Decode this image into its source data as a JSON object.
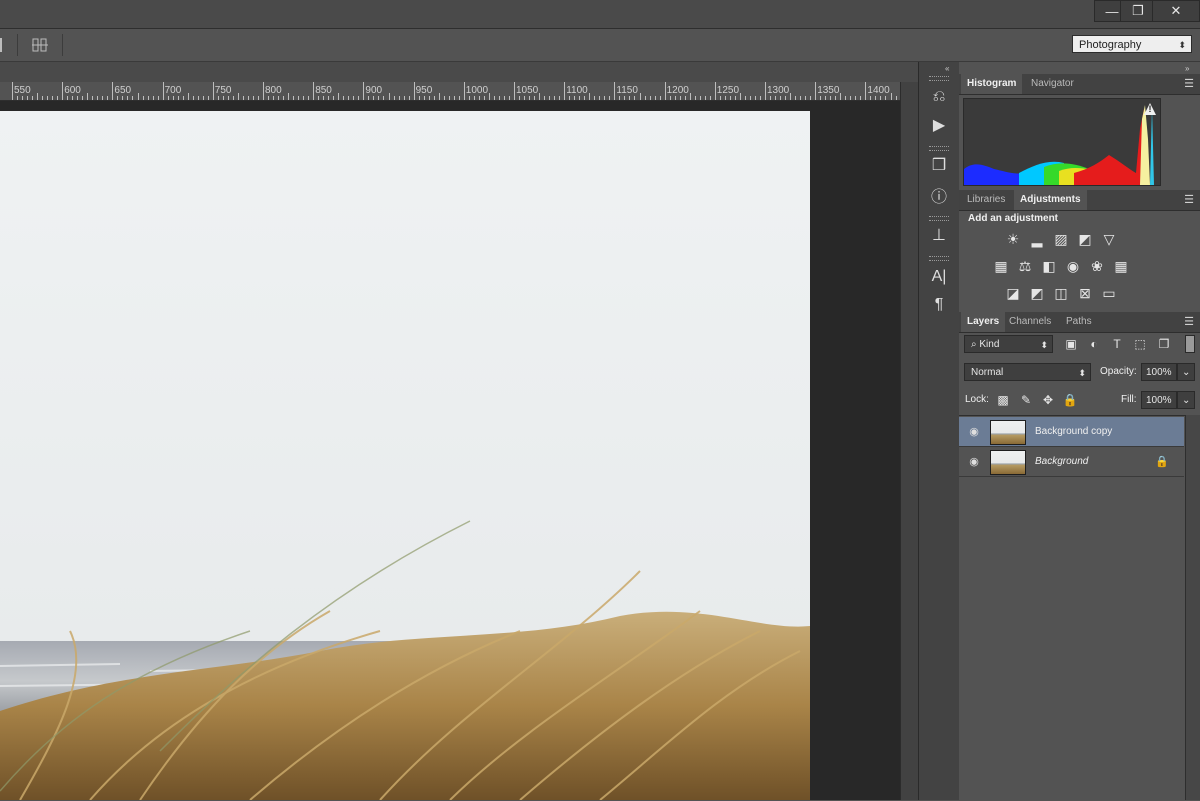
{
  "window_controls": {
    "minimize": "—",
    "restore": "❐",
    "close": "✕"
  },
  "options_bar": {
    "workspace": "Photography"
  },
  "ruler": {
    "unit_labels": [
      "550",
      "600",
      "650",
      "700",
      "750",
      "800",
      "850",
      "900",
      "950",
      "1000",
      "1050",
      "1100",
      "1150",
      "1200",
      "1250",
      "1300",
      "1350",
      "1400"
    ]
  },
  "panels": {
    "histogram": {
      "tabs": [
        "Histogram",
        "Navigator"
      ],
      "active": "Histogram",
      "warning": "!"
    },
    "adjustments": {
      "tabs": [
        "Libraries",
        "Adjustments"
      ],
      "active": "Adjustments",
      "heading": "Add an adjustment",
      "icons": [
        "brightness-contrast-icon",
        "levels-icon",
        "curves-icon",
        "exposure-icon",
        "vibrance-icon",
        "hue-saturation-icon",
        "color-balance-icon",
        "black-white-icon",
        "photo-filter-icon",
        "channel-mixer-icon",
        "color-lookup-icon",
        "invert-icon",
        "posterize-icon",
        "threshold-icon",
        "selective-color-icon",
        "gradient-map-icon"
      ]
    },
    "layers": {
      "tabs": [
        "Layers",
        "Channels",
        "Paths"
      ],
      "active": "Layers",
      "filter_kind": "Kind",
      "blend_mode": "Normal",
      "opacity_label": "Opacity:",
      "opacity_value": "100%",
      "lock_label": "Lock:",
      "fill_label": "Fill:",
      "fill_value": "100%",
      "layers": [
        {
          "name": "Background copy",
          "selected": true,
          "locked": false
        },
        {
          "name": "Background",
          "selected": false,
          "locked": true
        }
      ]
    }
  },
  "colors": {
    "selected_layer": "#6b7c95",
    "panel_bg": "#535353"
  }
}
